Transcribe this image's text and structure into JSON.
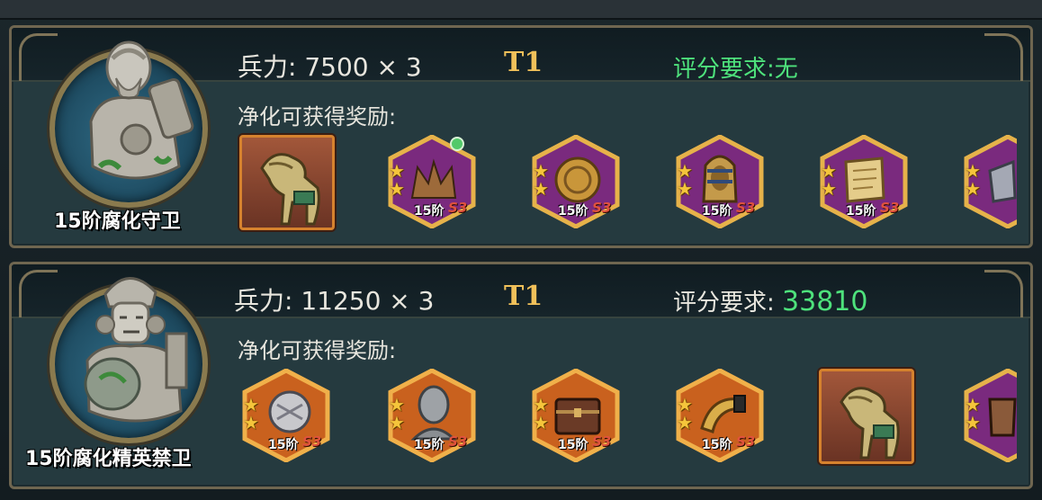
{
  "cards": [
    {
      "boss_name": "15阶腐化守卫",
      "troops": "兵力: 7500 × 3",
      "tier": "T1",
      "score_text": "评分要求:无",
      "rewards_label": "净化可获得奖励:",
      "rewards": [
        {
          "kind": "horse-figurine",
          "frame": "square",
          "color": "#c86a3c"
        },
        {
          "kind": "crown",
          "frame": "hex",
          "color": "#8a2c8c",
          "stars": 2,
          "tier": "15阶",
          "season": "S3",
          "gem": true
        },
        {
          "kind": "gold-coin",
          "frame": "hex",
          "color": "#8a2c8c",
          "stars": 2,
          "tier": "15阶",
          "season": "S3"
        },
        {
          "kind": "pharaoh-bust",
          "frame": "hex",
          "color": "#8a2c8c",
          "stars": 2,
          "tier": "15阶",
          "season": "S3"
        },
        {
          "kind": "scroll",
          "frame": "hex",
          "color": "#8a2c8c",
          "stars": 2,
          "tier": "15阶",
          "season": "S3"
        },
        {
          "kind": "partial-item",
          "frame": "hex",
          "color": "#8a2c8c",
          "stars": 2
        }
      ]
    },
    {
      "boss_name": "15阶腐化精英禁卫",
      "troops": "兵力: 11250 × 3",
      "tier": "T1",
      "score_label": "评分要求:",
      "score_value": "33810",
      "rewards_label": "净化可获得奖励:",
      "rewards": [
        {
          "kind": "silver-shield",
          "frame": "hex",
          "color": "#d4692a",
          "stars": 2,
          "tier": "15阶",
          "season": "S3"
        },
        {
          "kind": "stone-bust",
          "frame": "hex",
          "color": "#d4692a",
          "stars": 2,
          "tier": "15阶",
          "season": "S3"
        },
        {
          "kind": "treasure-chest",
          "frame": "hex",
          "color": "#d4692a",
          "stars": 2,
          "tier": "15阶",
          "season": "S3"
        },
        {
          "kind": "golden-horn",
          "frame": "hex",
          "color": "#d4692a",
          "stars": 2,
          "tier": "15阶",
          "season": "S3"
        },
        {
          "kind": "horse-figurine",
          "frame": "square",
          "color": "#c86a3c"
        },
        {
          "kind": "partial-item",
          "frame": "hex",
          "color": "#8a2c8c",
          "stars": 2
        }
      ]
    }
  ]
}
